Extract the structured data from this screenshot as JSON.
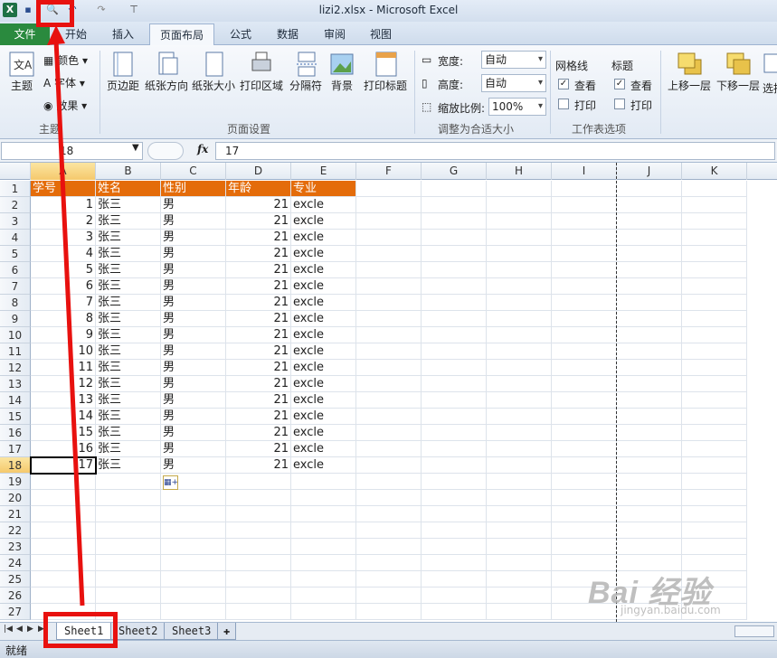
{
  "titlebar": {
    "title": "lizi2.xlsx - Microsoft Excel"
  },
  "tabs": [
    {
      "label": "文件",
      "id": "file"
    },
    {
      "label": "开始",
      "id": "home"
    },
    {
      "label": "插入",
      "id": "insert"
    },
    {
      "label": "页面布局",
      "id": "pagelayout"
    },
    {
      "label": "公式",
      "id": "formulas"
    },
    {
      "label": "数据",
      "id": "data"
    },
    {
      "label": "审阅",
      "id": "review"
    },
    {
      "label": "视图",
      "id": "view"
    }
  ],
  "ribbon": {
    "theme": {
      "main": "主题",
      "colors": "颜色",
      "fonts": "字体",
      "effects": "效果",
      "group": "主题"
    },
    "pagesetup": {
      "margins": "页边距",
      "orientation": "纸张方向",
      "size": "纸张大小",
      "printarea": "打印区域",
      "breaks": "分隔符",
      "background": "背景",
      "printtitles": "打印标题",
      "group": "页面设置"
    },
    "scale": {
      "width_label": "宽度:",
      "width_value": "自动",
      "height_label": "高度:",
      "height_value": "自动",
      "scale_label": "缩放比例:",
      "scale_value": "100%",
      "group": "调整为合适大小"
    },
    "sheetopts": {
      "gridlines": "网格线",
      "headings": "标题",
      "view": "查看",
      "print": "打印",
      "group": "工作表选项"
    },
    "arrange": {
      "forward": "上移一层",
      "backward": "下移一层",
      "select": "选择"
    }
  },
  "formula_bar": {
    "name_box": "18",
    "fx": "fx",
    "content": "17"
  },
  "columns": [
    "A",
    "B",
    "C",
    "D",
    "E",
    "F",
    "G",
    "H",
    "I",
    "J",
    "K"
  ],
  "header_row": [
    "学号",
    "姓名",
    "性别",
    "年龄",
    "专业"
  ],
  "rows": [
    [
      "1",
      "张三",
      "男",
      "21",
      "excle"
    ],
    [
      "2",
      "张三",
      "男",
      "21",
      "excle"
    ],
    [
      "3",
      "张三",
      "男",
      "21",
      "excle"
    ],
    [
      "4",
      "张三",
      "男",
      "21",
      "excle"
    ],
    [
      "5",
      "张三",
      "男",
      "21",
      "excle"
    ],
    [
      "6",
      "张三",
      "男",
      "21",
      "excle"
    ],
    [
      "7",
      "张三",
      "男",
      "21",
      "excle"
    ],
    [
      "8",
      "张三",
      "男",
      "21",
      "excle"
    ],
    [
      "9",
      "张三",
      "男",
      "21",
      "excle"
    ],
    [
      "10",
      "张三",
      "男",
      "21",
      "excle"
    ],
    [
      "11",
      "张三",
      "男",
      "21",
      "excle"
    ],
    [
      "12",
      "张三",
      "男",
      "21",
      "excle"
    ],
    [
      "13",
      "张三",
      "男",
      "21",
      "excle"
    ],
    [
      "14",
      "张三",
      "男",
      "21",
      "excle"
    ],
    [
      "15",
      "张三",
      "男",
      "21",
      "excle"
    ],
    [
      "16",
      "张三",
      "男",
      "21",
      "excle"
    ],
    [
      "17",
      "张三",
      "男",
      "21",
      "excle"
    ]
  ],
  "total_rows": 27,
  "active_row": 18,
  "sheets": [
    "Sheet1",
    "Sheet2",
    "Sheet3"
  ],
  "active_sheet": "Sheet1",
  "status": "就绪",
  "watermark": {
    "line1": "Bai 经验",
    "line2": "jingyan.baidu.com"
  },
  "colors": {
    "header_fill": "#e46c0a",
    "annotation": "#e8110f"
  }
}
